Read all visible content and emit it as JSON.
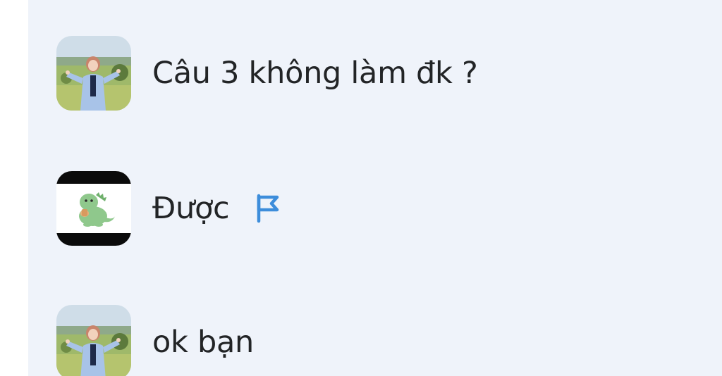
{
  "messages": [
    {
      "text": "Câu 3 không làm đk ?",
      "avatar": "girl-field-photo"
    },
    {
      "text": "Được",
      "avatar": "dinosaur-sticker",
      "flag_icon": "flag-icon",
      "flag_color": "#3d8ddb"
    },
    {
      "text": "ok bạn",
      "avatar": "girl-field-photo"
    }
  ],
  "colors": {
    "panel_background": "#eff3fa",
    "text": "#222426",
    "flag": "#3d8ddb"
  }
}
